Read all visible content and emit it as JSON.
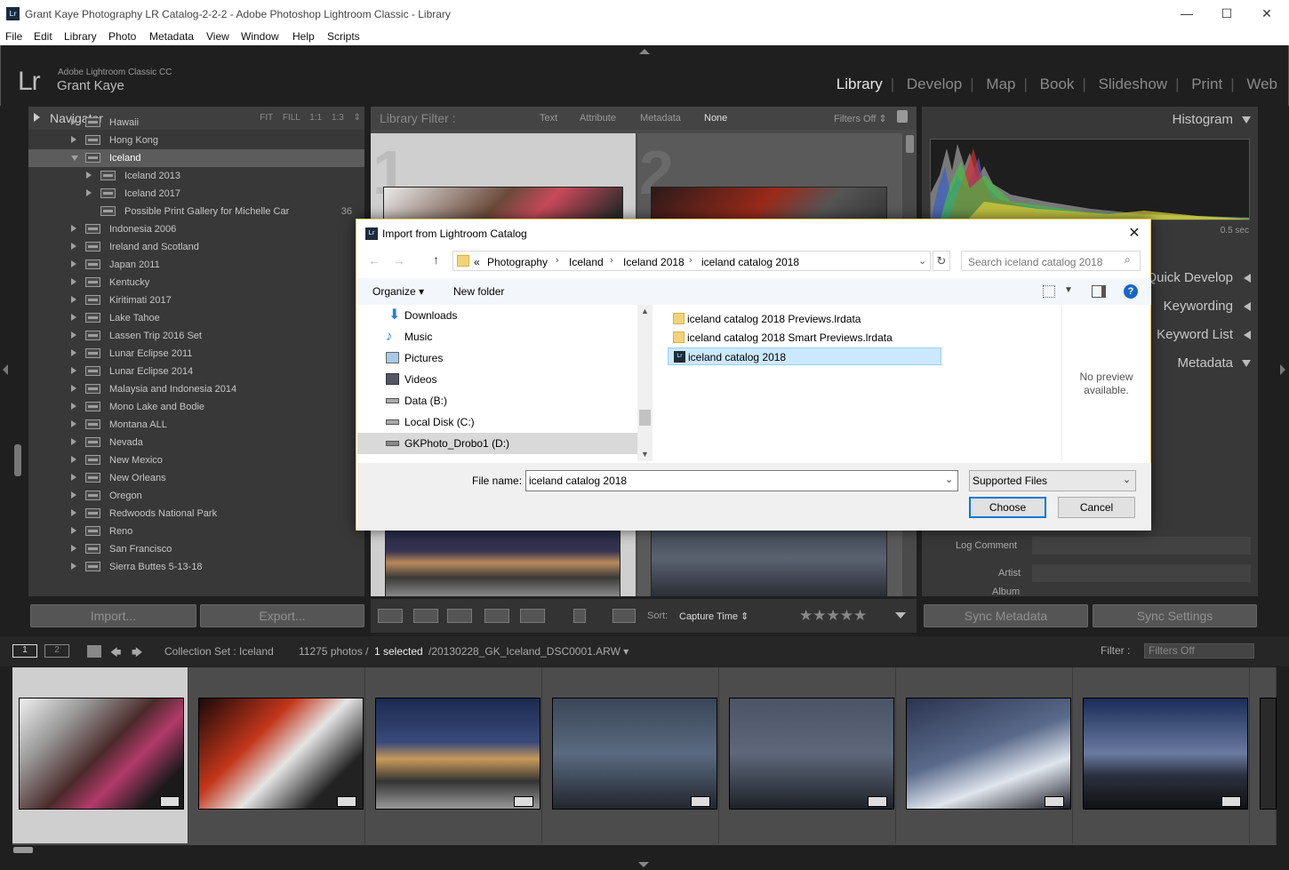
{
  "window": {
    "title": "Grant Kaye Photography LR Catalog-2-2-2 - Adobe Photoshop Lightroom Classic - Library",
    "minimize": "—",
    "maximize": "☐",
    "close": "✕"
  },
  "menu": [
    "File",
    "Edit",
    "Library",
    "Photo",
    "Metadata",
    "View",
    "Window",
    "Help",
    "Scripts"
  ],
  "identity": {
    "logo": "Lr",
    "product": "Adobe Lightroom Classic CC",
    "user": "Grant Kaye"
  },
  "modules": [
    "Library",
    "Develop",
    "Map",
    "Book",
    "Slideshow",
    "Print",
    "Web"
  ],
  "navigator": {
    "title": "Navigator",
    "zoom": "FIT FILL 1:1 1:3 ⇕"
  },
  "folders": [
    {
      "name": "Hawaii",
      "level": 0
    },
    {
      "name": "Hong Kong",
      "level": 0
    },
    {
      "name": "Iceland",
      "level": 0,
      "expanded": true,
      "selected": true
    },
    {
      "name": "Iceland 2013",
      "level": 1
    },
    {
      "name": "Iceland 2017",
      "level": 1
    },
    {
      "name": "Possible Print Gallery for Michelle Car",
      "level": 1,
      "count": "36"
    },
    {
      "name": "Indonesia 2006",
      "level": 0
    },
    {
      "name": "Ireland and Scotland",
      "level": 0
    },
    {
      "name": "Japan 2011",
      "level": 0
    },
    {
      "name": "Kentucky",
      "level": 0
    },
    {
      "name": "Kiritimati 2017",
      "level": 0
    },
    {
      "name": "Lake Tahoe",
      "level": 0
    },
    {
      "name": "Lassen Trip 2016 Set",
      "level": 0
    },
    {
      "name": "Lunar Eclipse 2011",
      "level": 0
    },
    {
      "name": "Lunar Eclipse 2014",
      "level": 0
    },
    {
      "name": "Malaysia and Indonesia 2014",
      "level": 0
    },
    {
      "name": "Mono Lake and Bodie",
      "level": 0
    },
    {
      "name": "Montana ALL",
      "level": 0
    },
    {
      "name": "Nevada",
      "level": 0
    },
    {
      "name": "New Mexico",
      "level": 0
    },
    {
      "name": "New Orleans",
      "level": 0
    },
    {
      "name": "Oregon",
      "level": 0
    },
    {
      "name": "Redwoods National Park",
      "level": 0
    },
    {
      "name": "Reno",
      "level": 0
    },
    {
      "name": "San Francisco",
      "level": 0
    },
    {
      "name": "Sierra Buttes 5-13-18",
      "level": 0
    }
  ],
  "left_buttons": {
    "import": "Import...",
    "export": "Export..."
  },
  "filter": {
    "label": "Library Filter :",
    "options": [
      "Text",
      "Attribute",
      "Metadata",
      "None"
    ],
    "filters_off": "Filters Off ⇕"
  },
  "grid_numbers": [
    "1",
    "2"
  ],
  "toolbar": {
    "sort_label": "Sort:",
    "sort_value": "Capture Time ⇕",
    "stars": "★★★★★"
  },
  "right_panel": {
    "histogram": "Histogram",
    "hist_value": "0.5 sec",
    "quick_develop": "Quick Develop",
    "keywording": "Keywording",
    "keyword_list": "Keyword List",
    "metadata": "Metadata",
    "log_comment": "Log Comment",
    "artist": "Artist",
    "album": "Album",
    "sync_metadata": "Sync Metadata",
    "sync_settings": "Sync Settings"
  },
  "filmbar": {
    "view1": "1",
    "view2": "2",
    "source": "Collection Set : Iceland",
    "count": "11275 photos /",
    "selected": "1 selected",
    "file": "/20130228_GK_Iceland_DSC0001.ARW ▾",
    "filter_label": "Filter :",
    "filter_value": "Filters Off"
  },
  "dialog": {
    "logo": "Lr",
    "title": "Import from Lightroom Catalog",
    "close": "✕",
    "breadcrumbs": [
      "«",
      "Photography",
      "Iceland",
      "Iceland 2018",
      "iceland catalog 2018"
    ],
    "search_placeholder": "Search iceland catalog 2018",
    "organize": "Organize ▾",
    "new_folder": "New folder",
    "nav_items": [
      "Downloads",
      "Music",
      "Pictures",
      "Videos",
      "Data (B:)",
      "Local Disk (C:)",
      "GKPhoto_Drobo1 (D:)"
    ],
    "files": [
      "iceland catalog 2018 Previews.lrdata",
      "iceland catalog 2018 Smart Previews.lrdata",
      "iceland catalog 2018"
    ],
    "no_preview": "No preview available.",
    "file_name_label": "File name:",
    "file_name_value": "iceland catalog 2018",
    "file_type": "Supported Files",
    "choose": "Choose",
    "cancel": "Cancel"
  },
  "colors": {
    "accent": "#0078d7",
    "lr_bg": "#1f1f1f",
    "panel": "#383838",
    "selection": "#cce8ff"
  }
}
